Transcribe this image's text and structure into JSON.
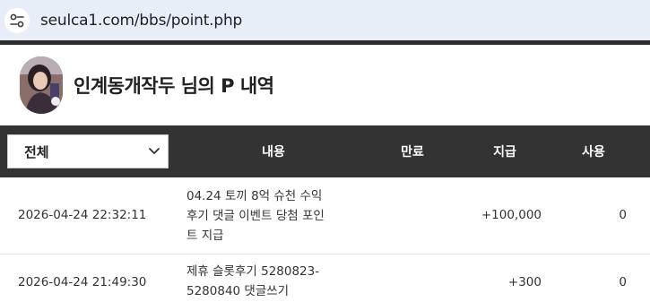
{
  "browser": {
    "url": "seulca1.com/bbs/point.php",
    "site_info_icon": "tune-icon"
  },
  "header": {
    "title": "인계동개작두 님의 P 내역",
    "avatar_icon": "user-avatar"
  },
  "table": {
    "filter": {
      "selected": "전체",
      "icon": "chevron-down-icon"
    },
    "columns": {
      "content": "내용",
      "expire": "만료",
      "give": "지급",
      "use": "사용"
    },
    "rows": [
      {
        "date": "2026-04-24 22:32:11",
        "content_lines": [
          "04.24 토끼 8억 슈천 수익",
          "후기 댓글 이벤트 당첨 포인",
          "트 지급"
        ],
        "expire": "",
        "give": "+100,000",
        "use": "0"
      },
      {
        "date": "2026-04-24 21:49:30",
        "content_lines": [
          "제휴 슬롯후기 5280823-",
          "5280840 댓글쓰기"
        ],
        "expire": "",
        "give": "+300",
        "use": "0"
      }
    ]
  }
}
